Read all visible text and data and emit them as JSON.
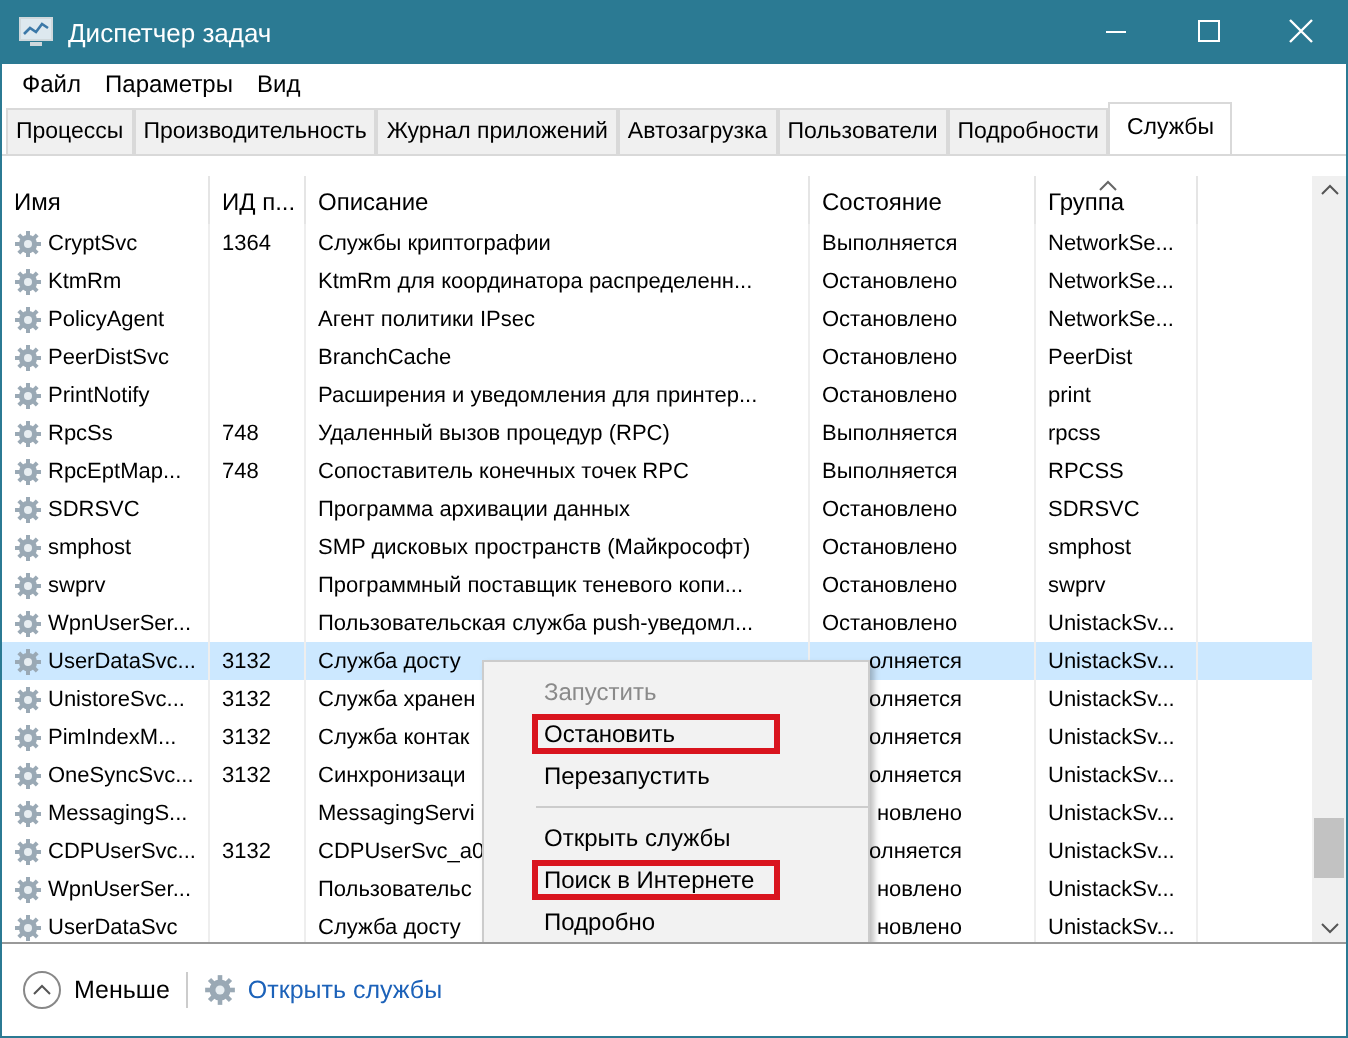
{
  "window": {
    "title": "Диспетчер задач"
  },
  "menu": [
    "Файл",
    "Параметры",
    "Вид"
  ],
  "tabs": [
    {
      "label": "Процессы",
      "selected": false
    },
    {
      "label": "Производительность",
      "selected": false
    },
    {
      "label": "Журнал приложений",
      "selected": false
    },
    {
      "label": "Автозагрузка",
      "selected": false
    },
    {
      "label": "Пользователи",
      "selected": false
    },
    {
      "label": "Подробности",
      "selected": false
    },
    {
      "label": "Службы",
      "selected": true
    }
  ],
  "table": {
    "columns": [
      "Имя",
      "ИД п...",
      "Описание",
      "Состояние",
      "Группа"
    ],
    "rows": [
      {
        "name": "CryptSvc",
        "pid": "1364",
        "description": "Службы криптографии",
        "state": "Выполняется",
        "group": "NetworkSe...",
        "selected": false,
        "covered": false
      },
      {
        "name": "KtmRm",
        "pid": "",
        "description": "KtmRm для координатора распределенн...",
        "state": "Остановлено",
        "group": "NetworkSe...",
        "selected": false,
        "covered": false
      },
      {
        "name": "PolicyAgent",
        "pid": "",
        "description": "Агент политики IPsec",
        "state": "Остановлено",
        "group": "NetworkSe...",
        "selected": false,
        "covered": false
      },
      {
        "name": "PeerDistSvc",
        "pid": "",
        "description": "BranchCache",
        "state": "Остановлено",
        "group": "PeerDist",
        "selected": false,
        "covered": false
      },
      {
        "name": "PrintNotify",
        "pid": "",
        "description": "Расширения и уведомления для принтер...",
        "state": "Остановлено",
        "group": "print",
        "selected": false,
        "covered": false
      },
      {
        "name": "RpcSs",
        "pid": "748",
        "description": "Удаленный вызов процедур (RPC)",
        "state": "Выполняется",
        "group": "rpcss",
        "selected": false,
        "covered": false
      },
      {
        "name": "RpcEptMap...",
        "pid": "748",
        "description": "Сопоставитель конечных точек RPC",
        "state": "Выполняется",
        "group": "RPCSS",
        "selected": false,
        "covered": false
      },
      {
        "name": "SDRSVC",
        "pid": "",
        "description": "Программа архивации данных",
        "state": "Остановлено",
        "group": "SDRSVC",
        "selected": false,
        "covered": false
      },
      {
        "name": "smphost",
        "pid": "",
        "description": "SMP дисковых пространств (Майкрософт)",
        "state": "Остановлено",
        "group": "smphost",
        "selected": false,
        "covered": false
      },
      {
        "name": "swprv",
        "pid": "",
        "description": "Программный поставщик теневого копи...",
        "state": "Остановлено",
        "group": "swprv",
        "selected": false,
        "covered": false
      },
      {
        "name": "WpnUserSer...",
        "pid": "",
        "description": "Пользовательская служба push-уведомл...",
        "state": "Остановлено",
        "group": "UnistackSv...",
        "selected": false,
        "covered": false
      },
      {
        "name": "UserDataSvc...",
        "pid": "3132",
        "description": "Служба досту",
        "state": "олняется",
        "group": "UnistackSv...",
        "selected": true,
        "covered": true
      },
      {
        "name": "UnistoreSvc...",
        "pid": "3132",
        "description": "Служба хранен",
        "state": "олняется",
        "group": "UnistackSv...",
        "selected": false,
        "covered": true
      },
      {
        "name": "PimIndexM...",
        "pid": "3132",
        "description": "Служба контак",
        "state": "олняется",
        "group": "UnistackSv...",
        "selected": false,
        "covered": true
      },
      {
        "name": "OneSyncSvc...",
        "pid": "3132",
        "description": "Синхронизаци",
        "state": "олняется",
        "group": "UnistackSv...",
        "selected": false,
        "covered": true
      },
      {
        "name": "MessagingS...",
        "pid": "",
        "description": "MessagingServi",
        "state": "новлено",
        "group": "UnistackSv...",
        "selected": false,
        "covered": true
      },
      {
        "name": "CDPUserSvc...",
        "pid": "3132",
        "description": "CDPUserSvc_a0",
        "state": "олняется",
        "group": "UnistackSv...",
        "selected": false,
        "covered": true
      },
      {
        "name": "WpnUserSer...",
        "pid": "",
        "description": "Пользовательс",
        "state": "новлено",
        "group": "UnistackSv...",
        "selected": false,
        "covered": true
      },
      {
        "name": "UserDataSvc",
        "pid": "",
        "description": "Служба досту",
        "state": "новлено",
        "group": "UnistackSv...",
        "selected": false,
        "covered": true
      }
    ]
  },
  "context_menu": [
    {
      "kind": "item",
      "label": "Запустить",
      "disabled": true,
      "highlighted": false
    },
    {
      "kind": "item",
      "label": "Остановить",
      "disabled": false,
      "highlighted": true
    },
    {
      "kind": "item",
      "label": "Перезапустить",
      "disabled": false,
      "highlighted": false
    },
    {
      "kind": "separator"
    },
    {
      "kind": "item",
      "label": "Открыть службы",
      "disabled": false,
      "highlighted": false
    },
    {
      "kind": "item",
      "label": "Поиск в Интернете",
      "disabled": false,
      "highlighted": true
    },
    {
      "kind": "item",
      "label": "Подробно",
      "disabled": false,
      "highlighted": false
    }
  ],
  "footer": {
    "less": "Меньше",
    "open_services": "Открыть службы"
  }
}
